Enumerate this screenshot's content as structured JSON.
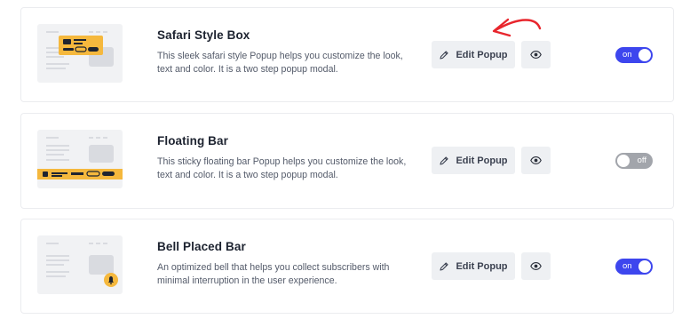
{
  "popups": [
    {
      "title": "Safari Style Box",
      "description": "This sleek safari style Popup helps you customize the look, text and color. It is a two step popup modal.",
      "edit_label": "Edit Popup",
      "toggle_label": "on",
      "enabled": true
    },
    {
      "title": "Floating Bar",
      "description": "This sticky floating bar Popup helps you customize the look, text and color. It is a two step popup modal.",
      "edit_label": "Edit Popup",
      "toggle_label": "off",
      "enabled": false
    },
    {
      "title": "Bell Placed Bar",
      "description": "An optimized bell that helps you collect subscribers with minimal interruption in the user experience.",
      "edit_label": "Edit Popup",
      "toggle_label": "on",
      "enabled": true
    }
  ],
  "icons": {
    "edit": "pencil-icon",
    "preview": "eye-icon",
    "annotation": "red-arrow"
  },
  "colors": {
    "toggle_on": "#3d46ee",
    "toggle_off": "#a2a5ab",
    "accent_yellow": "#f5b83d",
    "annotation_red": "#e8262d"
  }
}
